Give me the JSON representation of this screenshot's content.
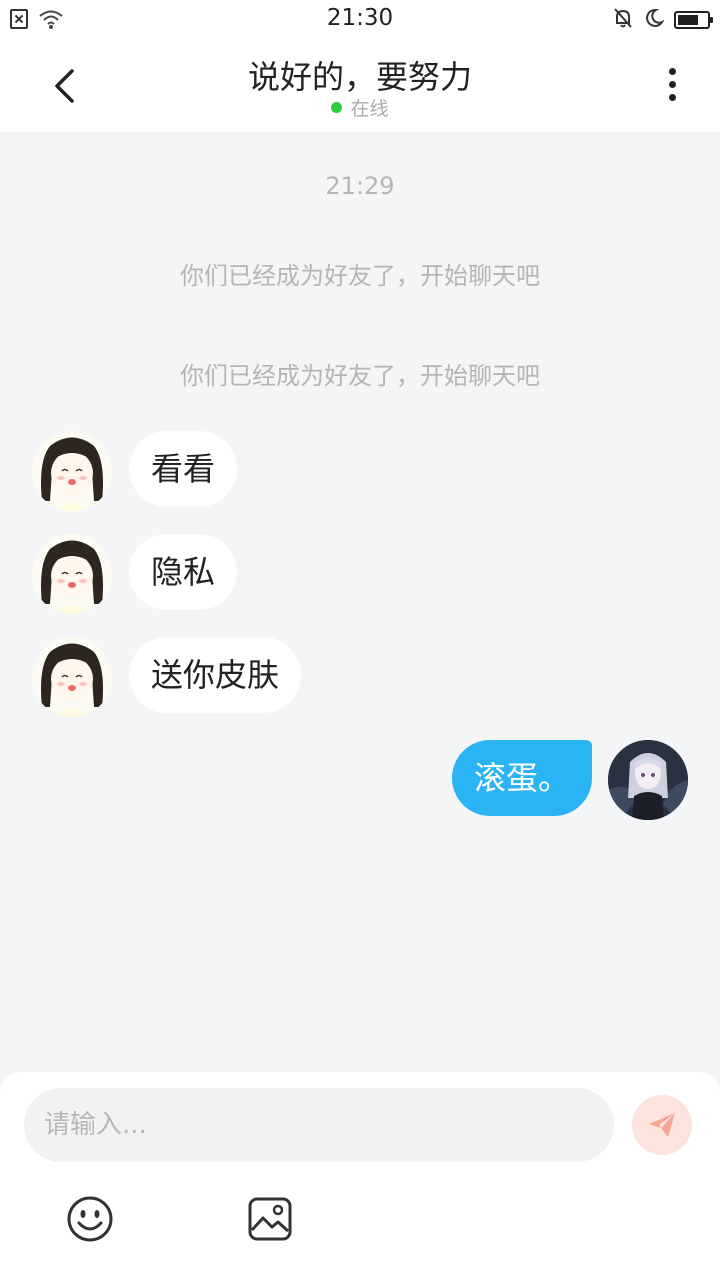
{
  "status_bar": {
    "time": "21:30",
    "icons": [
      "sim-off-icon",
      "wifi-icon",
      "mute-icon",
      "moon-icon",
      "battery-icon"
    ],
    "battery_level": 0.7
  },
  "header": {
    "back_icon": "chevron-left-icon",
    "title": "说好的，要努力",
    "status": "在线",
    "status_color": "#2ecc40",
    "more_icon": "more-vertical-icon"
  },
  "chat": {
    "timestamp": "21:29",
    "system_messages": [
      "你们已经成为好友了，开始聊天吧",
      "你们已经成为好友了，开始聊天吧"
    ],
    "messages": [
      {
        "side": "left",
        "text": "看看"
      },
      {
        "side": "left",
        "text": "隐私"
      },
      {
        "side": "left",
        "text": "送你皮肤"
      },
      {
        "side": "right",
        "text": "滚蛋。"
      }
    ],
    "incoming_bubble_color": "#ffffff",
    "outgoing_bubble_color": "#2bb4f5"
  },
  "input": {
    "placeholder": "请输入...",
    "send_icon": "send-icon",
    "tools": [
      "emoji-icon",
      "image-icon"
    ]
  }
}
